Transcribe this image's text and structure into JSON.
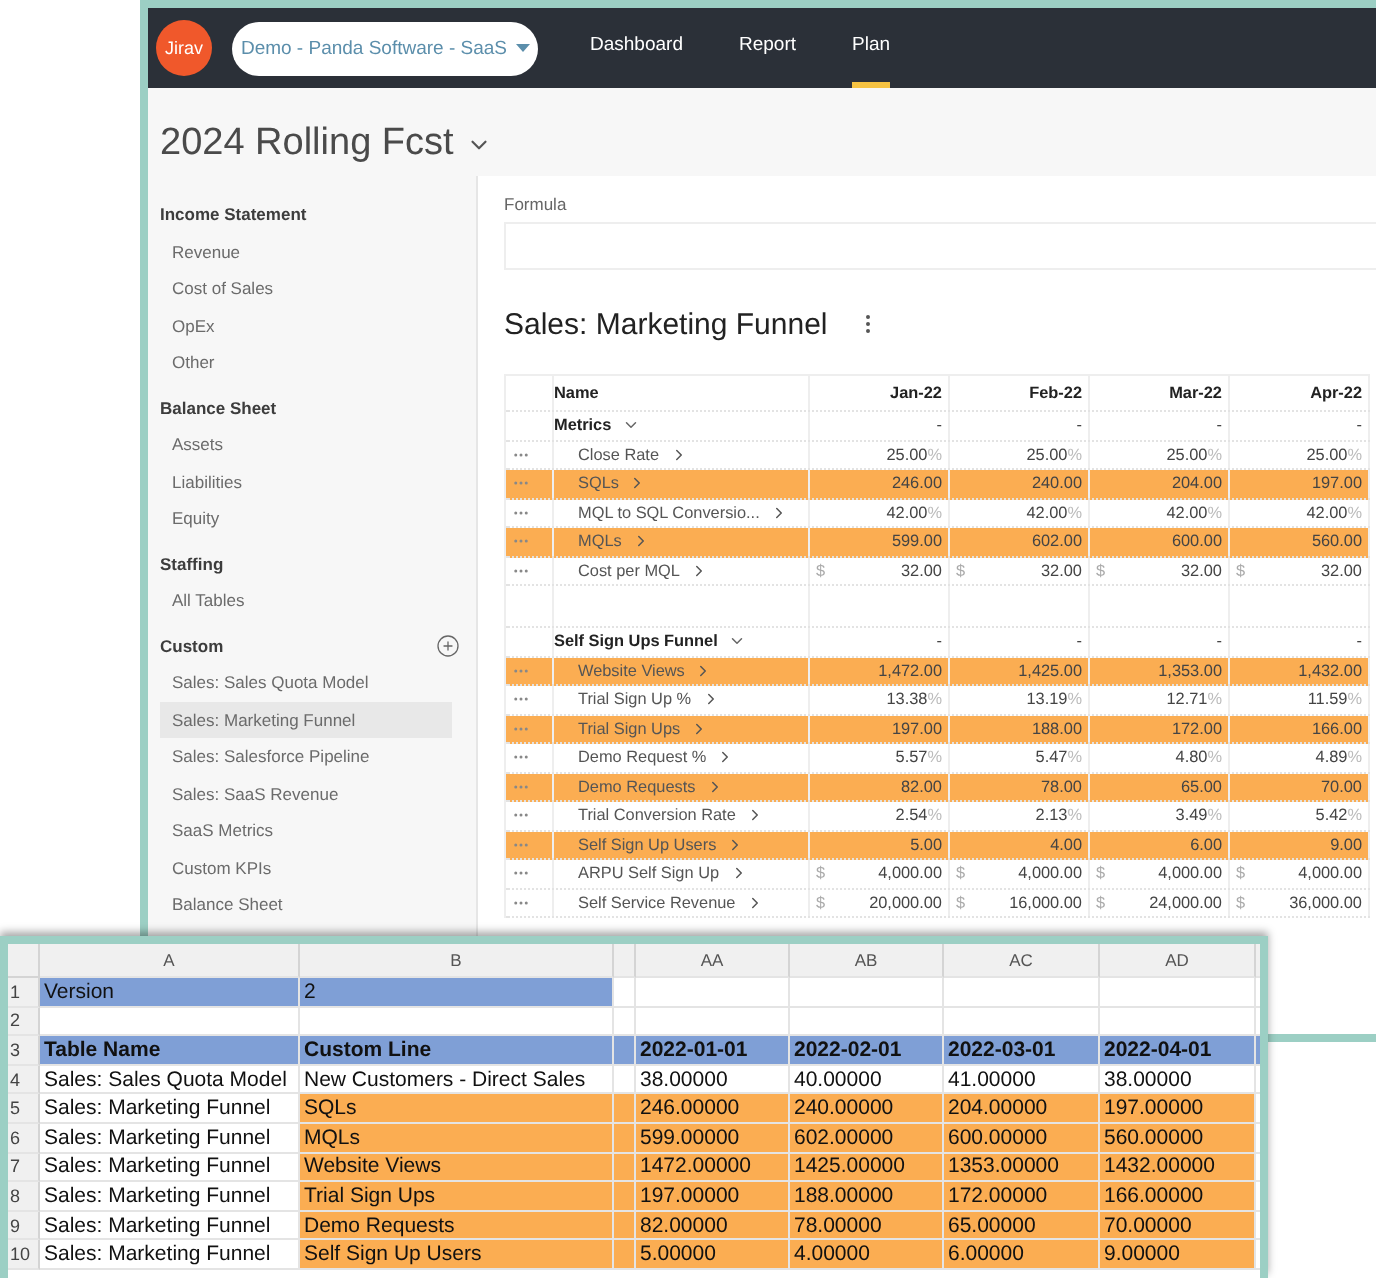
{
  "app": {
    "logo": "Jirav",
    "company_selector": "Demo - Panda Software - SaaS",
    "nav": [
      {
        "label": "Dashboard",
        "selected": false
      },
      {
        "label": "Report",
        "selected": false
      },
      {
        "label": "Plan",
        "selected": true
      }
    ],
    "page_title": "2024 Rolling Fcst"
  },
  "sidebar": {
    "sections": [
      {
        "heading": "Income Statement",
        "add_button": false,
        "items": [
          {
            "label": "Revenue",
            "selected": false
          },
          {
            "label": "Cost of Sales",
            "selected": false
          },
          {
            "label": "OpEx",
            "selected": false
          },
          {
            "label": "Other",
            "selected": false
          }
        ]
      },
      {
        "heading": "Balance Sheet",
        "add_button": false,
        "items": [
          {
            "label": "Assets",
            "selected": false
          },
          {
            "label": "Liabilities",
            "selected": false
          },
          {
            "label": "Equity",
            "selected": false
          }
        ]
      },
      {
        "heading": "Staffing",
        "add_button": false,
        "items": [
          {
            "label": "All Tables",
            "selected": false
          }
        ]
      },
      {
        "heading": "Custom",
        "add_button": true,
        "items": [
          {
            "label": "Sales: Sales Quota Model",
            "selected": false
          },
          {
            "label": "Sales: Marketing Funnel",
            "selected": true
          },
          {
            "label": "Sales: Salesforce Pipeline",
            "selected": false
          },
          {
            "label": "Sales: SaaS Revenue",
            "selected": false
          },
          {
            "label": "SaaS Metrics",
            "selected": false
          },
          {
            "label": "Custom KPIs",
            "selected": false
          },
          {
            "label": "Balance Sheet",
            "selected": false
          }
        ]
      }
    ]
  },
  "formula": {
    "label": "Formula"
  },
  "table_title": "Sales: Marketing Funnel",
  "table": {
    "columns": [
      "Name",
      "Jan-22",
      "Feb-22",
      "Mar-22",
      "Apr-22"
    ],
    "rows": [
      {
        "kind": "group",
        "name": "Metrics",
        "values": [
          "-",
          "-",
          "-",
          "-"
        ]
      },
      {
        "kind": "line",
        "name": "Close Rate",
        "highlighted": false,
        "suffix": "%",
        "values": [
          "25.00",
          "25.00",
          "25.00",
          "25.00"
        ]
      },
      {
        "kind": "line",
        "name": "SQLs",
        "highlighted": true,
        "values": [
          "246.00",
          "240.00",
          "204.00",
          "197.00"
        ]
      },
      {
        "kind": "line",
        "name": "MQL to SQL Conversio...",
        "highlighted": false,
        "suffix": "%",
        "values": [
          "42.00",
          "42.00",
          "42.00",
          "42.00"
        ]
      },
      {
        "kind": "line",
        "name": "MQLs",
        "highlighted": true,
        "values": [
          "599.00",
          "602.00",
          "600.00",
          "560.00"
        ]
      },
      {
        "kind": "line",
        "name": "Cost per MQL",
        "highlighted": false,
        "prefix": "$",
        "values": [
          "32.00",
          "32.00",
          "32.00",
          "32.00"
        ]
      },
      {
        "kind": "blank"
      },
      {
        "kind": "group",
        "name": "Self Sign Ups Funnel",
        "values": [
          "-",
          "-",
          "-",
          "-"
        ]
      },
      {
        "kind": "line",
        "name": "Website Views",
        "highlighted": true,
        "values": [
          "1,472.00",
          "1,425.00",
          "1,353.00",
          "1,432.00"
        ]
      },
      {
        "kind": "line",
        "name": "Trial Sign Up %",
        "highlighted": false,
        "suffix": "%",
        "values": [
          "13.38",
          "13.19",
          "12.71",
          "11.59"
        ]
      },
      {
        "kind": "line",
        "name": "Trial Sign Ups",
        "highlighted": true,
        "values": [
          "197.00",
          "188.00",
          "172.00",
          "166.00"
        ]
      },
      {
        "kind": "line",
        "name": "Demo Request %",
        "highlighted": false,
        "suffix": "%",
        "values": [
          "5.57",
          "5.47",
          "4.80",
          "4.89"
        ]
      },
      {
        "kind": "line",
        "name": "Demo Requests",
        "highlighted": true,
        "values": [
          "82.00",
          "78.00",
          "65.00",
          "70.00"
        ]
      },
      {
        "kind": "line",
        "name": "Trial Conversion Rate",
        "highlighted": false,
        "suffix": "%",
        "values": [
          "2.54",
          "2.13",
          "3.49",
          "5.42"
        ]
      },
      {
        "kind": "line",
        "name": "Self Sign Up Users",
        "highlighted": true,
        "values": [
          "5.00",
          "4.00",
          "6.00",
          "9.00"
        ]
      },
      {
        "kind": "line",
        "name": "ARPU Self Sign Up",
        "highlighted": false,
        "prefix": "$",
        "values": [
          "4,000.00",
          "4,000.00",
          "4,000.00",
          "4,000.00"
        ]
      },
      {
        "kind": "line",
        "name": "Self Service Revenue",
        "highlighted": false,
        "prefix": "$",
        "values": [
          "20,000.00",
          "16,000.00",
          "24,000.00",
          "36,000.00"
        ]
      }
    ]
  },
  "spreadsheet": {
    "columns": [
      "A",
      "B",
      "AA",
      "AB",
      "AC",
      "AD"
    ],
    "rows": [
      {
        "number": "1",
        "kind": "meta",
        "cells": [
          "Version",
          "2"
        ]
      },
      {
        "number": "2",
        "kind": "blank"
      },
      {
        "number": "3",
        "kind": "header",
        "cells": [
          "Table Name",
          "Custom Line",
          "2022-01-01",
          "2022-02-01",
          "2022-03-01",
          "2022-04-01"
        ]
      },
      {
        "number": "4",
        "kind": "data",
        "highlighted": false,
        "cells": [
          "Sales: Sales Quota Model",
          "New Customers - Direct Sales",
          "38.00000",
          "40.00000",
          "41.00000",
          "38.00000"
        ]
      },
      {
        "number": "5",
        "kind": "data",
        "highlighted": true,
        "cells": [
          "Sales: Marketing Funnel",
          "SQLs",
          "246.00000",
          "240.00000",
          "204.00000",
          "197.00000"
        ]
      },
      {
        "number": "6",
        "kind": "data",
        "highlighted": true,
        "cells": [
          "Sales: Marketing Funnel",
          "MQLs",
          "599.00000",
          "602.00000",
          "600.00000",
          "560.00000"
        ]
      },
      {
        "number": "7",
        "kind": "data",
        "highlighted": true,
        "cells": [
          "Sales: Marketing Funnel",
          "Website Views",
          "1472.00000",
          "1425.00000",
          "1353.00000",
          "1432.00000"
        ]
      },
      {
        "number": "8",
        "kind": "data",
        "highlighted": true,
        "cells": [
          "Sales: Marketing Funnel",
          "Trial Sign Ups",
          "197.00000",
          "188.00000",
          "172.00000",
          "166.00000"
        ]
      },
      {
        "number": "9",
        "kind": "data",
        "highlighted": true,
        "cells": [
          "Sales: Marketing Funnel",
          "Demo Requests",
          "82.00000",
          "78.00000",
          "65.00000",
          "70.00000"
        ]
      },
      {
        "number": "10",
        "kind": "data",
        "highlighted": true,
        "cells": [
          "Sales: Marketing Funnel",
          "Self Sign Up Users",
          "5.00000",
          "4.00000",
          "6.00000",
          "9.00000"
        ]
      }
    ]
  }
}
